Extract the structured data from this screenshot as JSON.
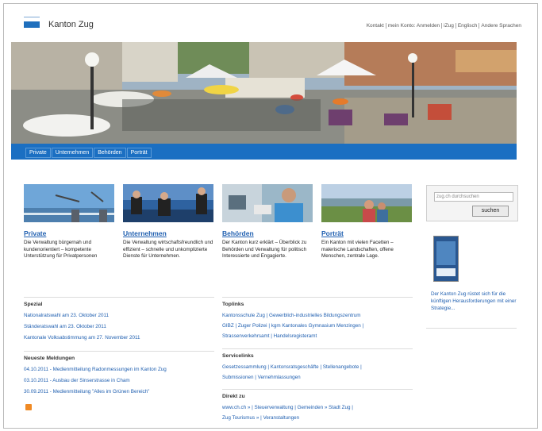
{
  "header": {
    "title": "Kanton Zug",
    "topnav": [
      "Kontakt",
      "mein Konto: Anmelden",
      "iZug",
      "Englisch",
      "Andere Sprachen"
    ]
  },
  "mainnav": {
    "tabs": [
      "Private",
      "Unternehmen",
      "Behörden",
      "Porträt"
    ]
  },
  "columns": [
    {
      "title": "Private",
      "text": "Die Verwaltung bürgernah und kundenorientiert – kompetente Unterstützung für Privatpersonen"
    },
    {
      "title": "Unternehmen",
      "text": "Die Verwaltung wirtschaftsfreundlich und effizient – schnelle und unkomplizierte Dienste für Unternehmen."
    },
    {
      "title": "Behörden",
      "text": "Der Kanton kurz erklärt – Überblick zu Behörden und Verwaltung für politisch Interessierte und Engagierte."
    },
    {
      "title": "Porträt",
      "text": "Ein Kanton mit vielen Facetten – malerische Landschaften, offene Menschen, zentrale Lage."
    }
  ],
  "search": {
    "placeholder": "zug.ch durchsuchen",
    "button": "suchen"
  },
  "sidebar": {
    "text": "Der Kanton Zug rüstet sich für die künftigen Herausforderungen mit einer Strategie..."
  },
  "spezial": {
    "title": "Spezial",
    "links": [
      "Nationalratswahl am 23. Oktober 2011",
      "Ständeratswahl am 23. Oktober 2011",
      "Kantonale Volksabstimmung am 27. November 2011"
    ]
  },
  "news": {
    "title": "Neueste Meldungen",
    "links": [
      "04.10.2011 - Medienmitteilung Radonmessungen im Kanton Zug",
      "03.10.2011 - Ausbau der Sinserstrasse in Cham",
      "30.09.2011 - Medienmitteilung \"Alles im Grünen Bereich\""
    ]
  },
  "toplinks": {
    "title": "Toplinks",
    "lines": [
      "Kantonsschule Zug | Gewerblich-industrielles Bildungszentrum",
      "GIBZ | Zuger Polizei | kgm Kantonales Gymnasium Menzingen |",
      "Strassenverkehrsamt | Handelsregisteramt"
    ]
  },
  "service": {
    "title": "Servicelinks",
    "lines": [
      "Gesetzessammlung | Kantonsratsgeschäfte | Stellenangebote |",
      "Submissionen | Vernehmlassungen"
    ]
  },
  "direkt": {
    "title": "Direkt zu",
    "lines": [
      "www.ch.ch » | Steuerverwaltung | Gemeinden » Stadt Zug |",
      "Zug Tourismus » | Veranstaltungen"
    ]
  },
  "colors": {
    "brand": "#1b6fc2",
    "link": "#1f5fb0"
  }
}
